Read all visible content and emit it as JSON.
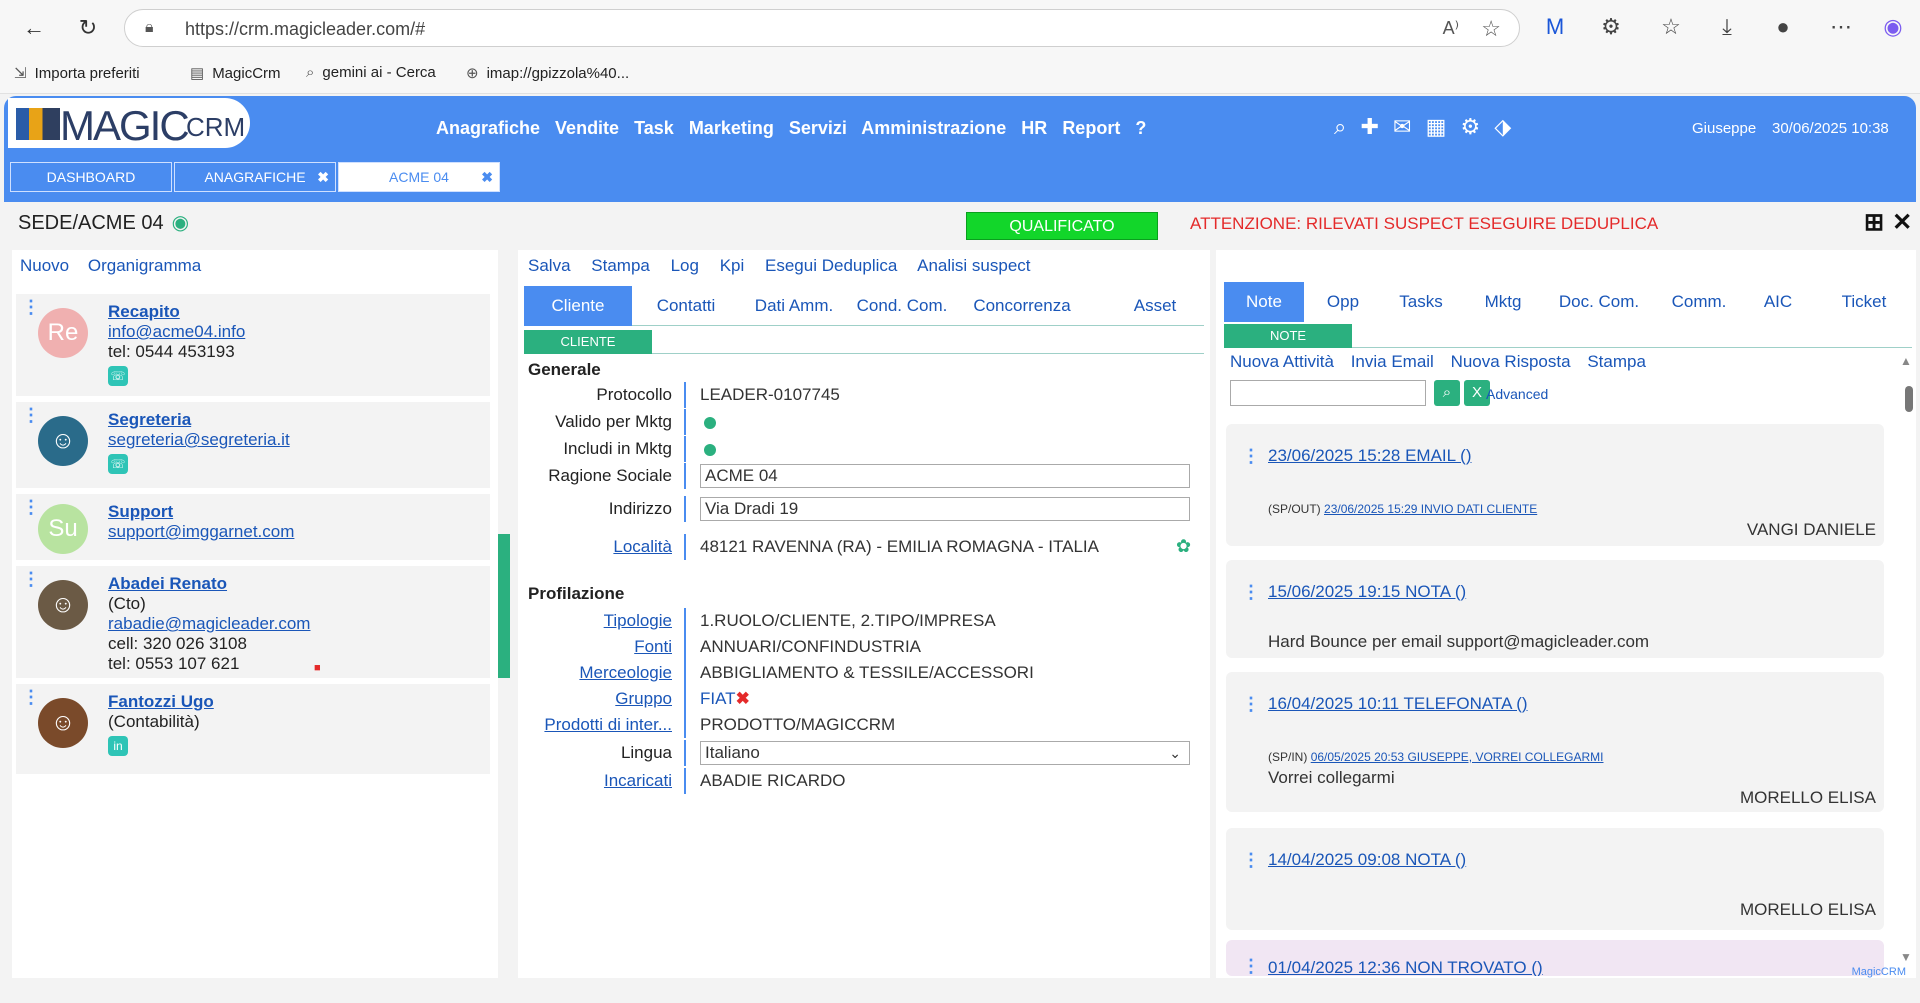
{
  "browser": {
    "url": "https://crm.magicleader.com/#",
    "bookmarks": [
      "Importa preferiti",
      "MagicCrm",
      "gemini ai - Cerca",
      "imap://gpizzola%40..."
    ]
  },
  "app": {
    "logo_word": "MAGIC",
    "logo_suffix": "CRM",
    "menu": [
      "Anagrafiche",
      "Vendite",
      "Task",
      "Marketing",
      "Servizi",
      "Amministrazione",
      "HR",
      "Report",
      "?"
    ],
    "header_icons": [
      "search-icon",
      "plus-icon",
      "mail-icon",
      "calendar-icon",
      "gear-icon",
      "tag-icon"
    ],
    "user": "Giuseppe",
    "datetime": "30/06/2025 10:38",
    "window_tabs": [
      {
        "label": "DASHBOARD",
        "active": false,
        "closable": false
      },
      {
        "label": "ANAGRAFICHE",
        "active": false,
        "closable": true
      },
      {
        "label": "ACME 04",
        "active": true,
        "closable": true
      }
    ],
    "accent": "#4a8cf0",
    "green": "#2bb07f"
  },
  "page": {
    "title": "SEDE/ACME 04",
    "status": "QUALIFICATO",
    "warning": "ATTENZIONE: RILEVATI SUSPECT ESEGUIRE DEDUPLICA"
  },
  "left": {
    "links": [
      "Nuovo",
      "Organigramma"
    ],
    "contacts": [
      {
        "initials": "Re",
        "name": "Recapito",
        "role": "",
        "email": "info@acme04.info",
        "lines": [
          "tel: 0544 453193"
        ],
        "avatar_color": "#f0b0b0",
        "badge": "whatsapp-icon"
      },
      {
        "initials": "",
        "name": "Segreteria",
        "role": "",
        "email": "segreteria@segreteria.it",
        "lines": [],
        "avatar_color": "#2a6b8a",
        "badge": "whatsapp-icon"
      },
      {
        "initials": "Su",
        "name": "Support",
        "role": "",
        "email": "support@imggarnet.com",
        "lines": [],
        "avatar_color": "#b8e3a0",
        "badge": ""
      },
      {
        "initials": "",
        "name": "Abadei Renato",
        "role": "(Cto)",
        "email": "rabadie@magicleader.com",
        "lines": [
          "cell: 320 026 3108",
          "tel: 0553 107 621"
        ],
        "avatar_color": "#6b5a45",
        "badge": ""
      },
      {
        "initials": "",
        "name": "Fantozzi Ugo",
        "role": "(Contabilità)",
        "email": "",
        "lines": [],
        "avatar_color": "#7a4a2a",
        "badge": "linkedin-icon"
      }
    ]
  },
  "middle": {
    "links": [
      "Salva",
      "Stampa",
      "Log",
      "Kpi",
      "Esegui Deduplica",
      "Analisi suspect"
    ],
    "tabs": [
      "Cliente",
      "Contatti",
      "Dati Amm.",
      "Cond. Com.",
      "Concorrenza",
      "Asset"
    ],
    "section": "CLIENTE",
    "group_generale": "Generale",
    "group_profilazione": "Profilazione",
    "fields": {
      "protocollo_label": "Protocollo",
      "protocollo": "LEADER-0107745",
      "valido_label": "Valido per Mktg",
      "includi_label": "Includi in Mktg",
      "ragione_label": "Ragione Sociale",
      "ragione": "ACME 04",
      "indirizzo_label": "Indirizzo",
      "indirizzo": "Via Dradi 19",
      "localita_label": "Località",
      "localita": "48121 RAVENNA (RA) - EMILIA ROMAGNA - ITALIA",
      "tipologie_label": "Tipologie",
      "tipologie": "1.RUOLO/CLIENTE, 2.TIPO/IMPRESA",
      "fonti_label": "Fonti",
      "fonti": "ANNUARI/CONFINDUSTRIA",
      "merceologie_label": "Merceologie",
      "merceologie": "ABBIGLIAMENTO & TESSILE/ACCESSORI",
      "gruppo_label": "Gruppo",
      "gruppo": "FIAT",
      "prodotti_label": "Prodotti di inter...",
      "prodotti": "PRODOTTO/MAGICCRM",
      "lingua_label": "Lingua",
      "lingua": "Italiano",
      "incaricati_label": "Incaricati",
      "incaricati": "ABADIE RICARDO"
    }
  },
  "right": {
    "tabs": [
      "Note",
      "Opp",
      "Tasks",
      "Mktg",
      "Doc. Com.",
      "Comm.",
      "AIC",
      "Ticket"
    ],
    "section": "NOTE",
    "links": [
      "Nuova Attività",
      "Invia Email",
      "Nuova Risposta",
      "Stampa"
    ],
    "search_placeholder": "",
    "advanced": "Advanced",
    "activities": [
      {
        "title": "23/06/2025 15:28 EMAIL ()",
        "sub_prefix": "(SP/OUT)",
        "sub_link": "23/06/2025 15:29 INVIO DATI CLIENTE",
        "body": "",
        "who": "VANGI DANIELE"
      },
      {
        "title": "15/06/2025 19:15 NOTA ()",
        "sub_prefix": "",
        "sub_link": "",
        "body": "Hard Bounce per email support@magicleader.com",
        "who": ""
      },
      {
        "title": "16/04/2025 10:11 TELEFONATA ()",
        "sub_prefix": "(SP/IN)",
        "sub_link": "06/05/2025 20:53 GIUSEPPE, VORREI COLLEGARMI",
        "body": "Vorrei collegarmi",
        "who": "MORELLO ELISA"
      },
      {
        "title": "14/04/2025 09:08 NOTA ()",
        "sub_prefix": "",
        "sub_link": "",
        "body": "",
        "who": "MORELLO ELISA"
      },
      {
        "title": "01/04/2025 12:36 NON TROVATO ()",
        "sub_prefix": "",
        "sub_link": "",
        "body": "",
        "who": ""
      }
    ]
  },
  "footer": "MagicCRM"
}
